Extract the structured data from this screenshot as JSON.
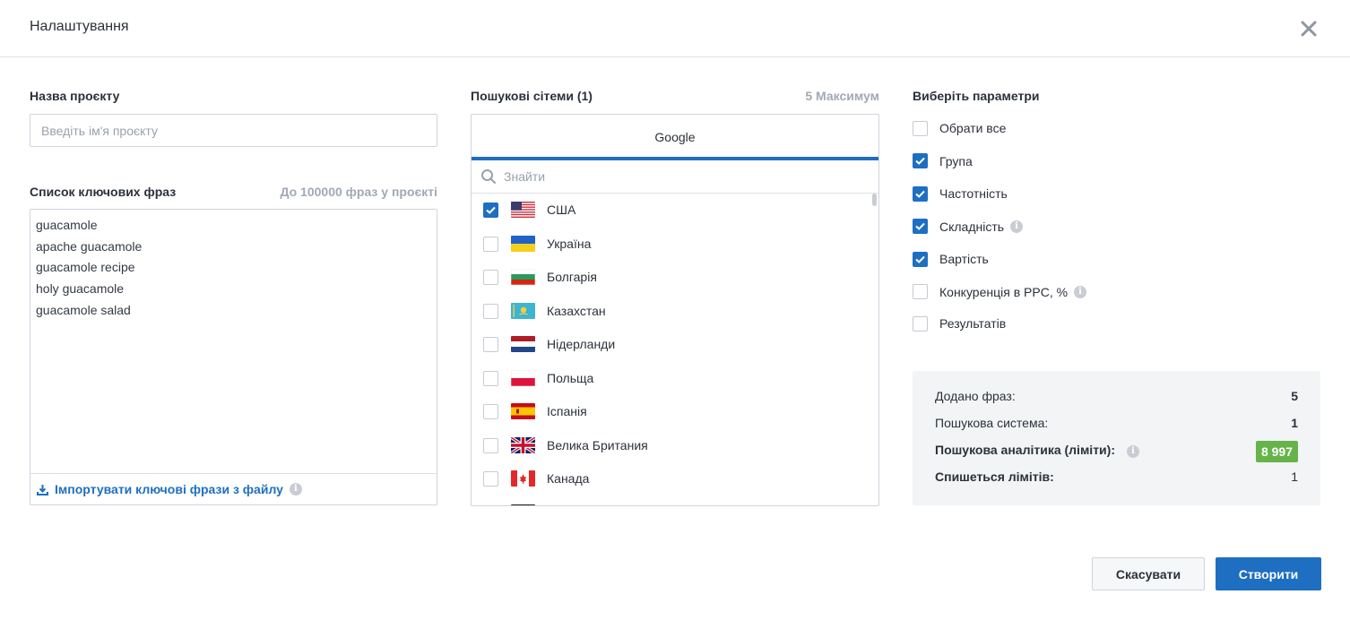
{
  "header": {
    "title": "Налаштування"
  },
  "project": {
    "label": "Назва проєкту",
    "placeholder": "Введіть ім'я проєкту",
    "value": ""
  },
  "keywords": {
    "label": "Список ключових фраз",
    "limit_hint": "До 100000 фраз у проєкті",
    "text": "guacamole\napache guacamole\nguacamole recipe\nholy guacamole\nguacamole salad",
    "import_label": "Імпортувати ключові фрази з файлу"
  },
  "search_engines": {
    "label": "Пошукові сітеми (1)",
    "max_hint": "5 Максимум",
    "tab_label": "Google",
    "search_placeholder": "Знайти",
    "items": [
      {
        "name": "США",
        "flag": "us-flag",
        "checked": true
      },
      {
        "name": "Україна",
        "flag": "ua-flag",
        "checked": false
      },
      {
        "name": "Болгарія",
        "flag": "bg-flag",
        "checked": false
      },
      {
        "name": "Казахстан",
        "flag": "kz-flag",
        "checked": false
      },
      {
        "name": "Нідерланди",
        "flag": "nl-flag",
        "checked": false
      },
      {
        "name": "Польща",
        "flag": "pl-flag",
        "checked": false
      },
      {
        "name": "Іспанія",
        "flag": "es-flag",
        "checked": false
      },
      {
        "name": "Велика Британия",
        "flag": "gb-flag",
        "checked": false
      },
      {
        "name": "Канада",
        "flag": "ca-flag",
        "checked": false
      }
    ]
  },
  "parameters": {
    "label": "Виберіть параметри",
    "items": [
      {
        "name": "Обрати все",
        "checked": false,
        "info": false
      },
      {
        "name": "Група",
        "checked": true,
        "info": false
      },
      {
        "name": "Частотність",
        "checked": true,
        "info": false
      },
      {
        "name": "Складність",
        "checked": true,
        "info": true
      },
      {
        "name": "Вартість",
        "checked": true,
        "info": false
      },
      {
        "name": "Конкуренція в PPC, %",
        "checked": false,
        "info": true
      },
      {
        "name": "Результатів",
        "checked": false,
        "info": false
      }
    ]
  },
  "summary": {
    "phrases_label": "Додано фраз:",
    "phrases_value": "5",
    "engines_label": "Пошукова система:",
    "engines_value": "1",
    "limits_label": "Пошукова аналітика (ліміти):",
    "limits_value": "8 997",
    "spend_label": "Спишеться лімітів:",
    "spend_value": "1"
  },
  "buttons": {
    "cancel": "Скасувати",
    "create": "Створити"
  },
  "colors": {
    "accent": "#1e6fc2",
    "badge": "#66b34a",
    "panel_bg": "#f2f4f6"
  }
}
